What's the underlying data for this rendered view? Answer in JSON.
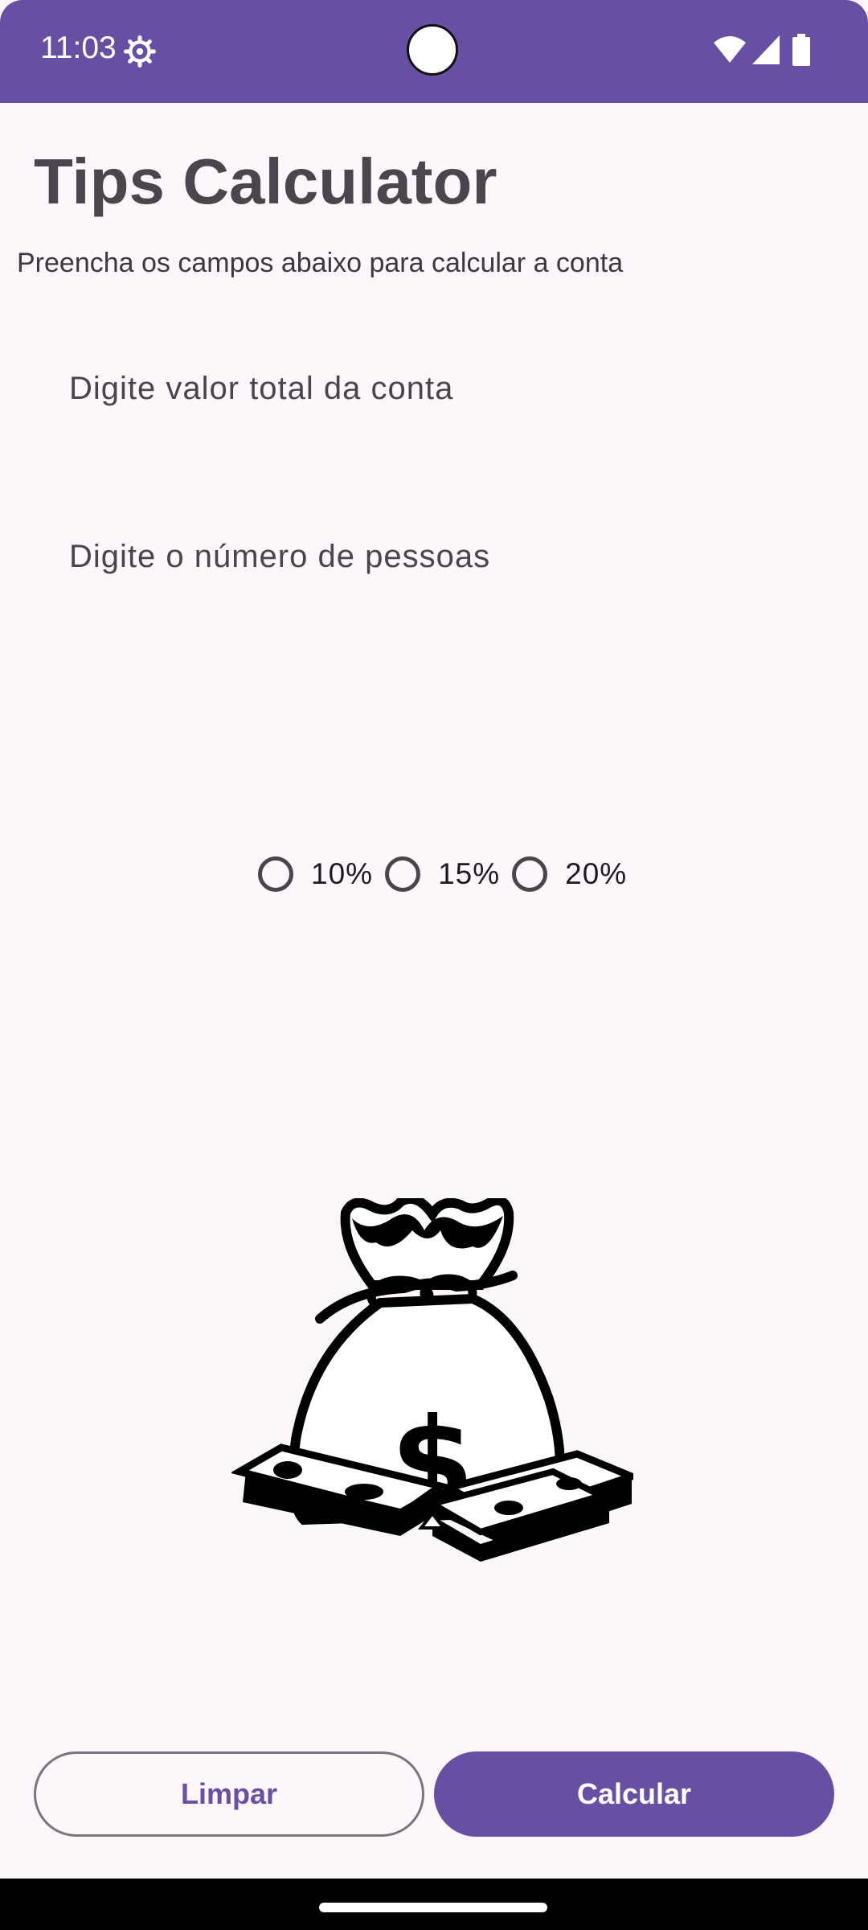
{
  "status_bar": {
    "time": "11:03",
    "icons": [
      "settings-gear-icon",
      "camera-cutout",
      "wifi-icon",
      "signal-icon",
      "battery-icon"
    ],
    "background": "#6750a4"
  },
  "header": {
    "title": "Tips Calculator",
    "subtitle": "Preencha os campos abaixo para calcular a conta"
  },
  "form": {
    "total_placeholder": "Digite valor total da conta",
    "total_value": "",
    "people_placeholder": "Digite o número de pessoas",
    "people_value": ""
  },
  "tip_options": [
    {
      "label": "10%",
      "selected": false
    },
    {
      "label": "15%",
      "selected": false
    },
    {
      "label": "20%",
      "selected": false
    }
  ],
  "image": {
    "icon": "money-bag-icon"
  },
  "buttons": {
    "clear_label": "Limpar",
    "calculate_label": "Calcular"
  },
  "colors": {
    "primary": "#6750a4",
    "background": "#fdf7fc",
    "text": "#49454f",
    "outline": "#79747e"
  }
}
